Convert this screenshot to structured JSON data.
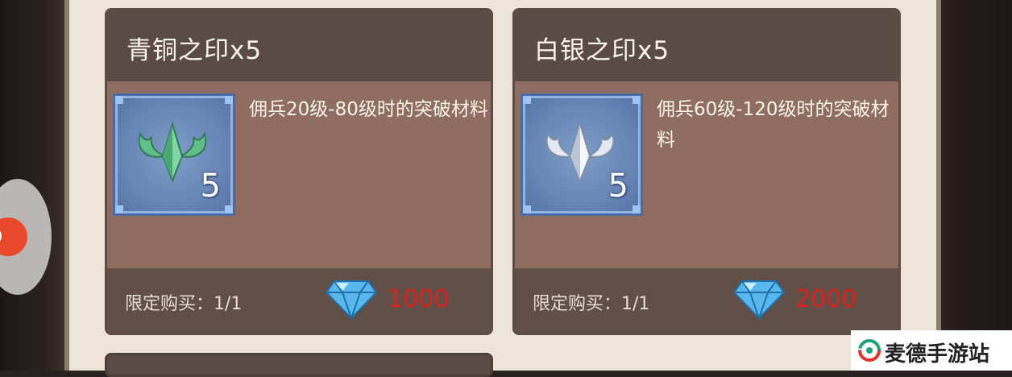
{
  "cards": [
    {
      "title": "青铜之印x5",
      "description": "佣兵20级-80级时的突破材料",
      "count": "5",
      "limit": "限定购买：1/1",
      "price": "1000",
      "icon": "bronze-seal-icon",
      "icon_color": "#6fc38e"
    },
    {
      "title": "白银之印x5",
      "description": "佣兵60级-120级时的突破材料",
      "count": "5",
      "limit": "限定购买：1/1",
      "price": "2000",
      "icon": "silver-seal-icon",
      "icon_color": "#e6ecf4"
    }
  ],
  "currency_icon": "diamond-icon",
  "price_color": "#d8221a",
  "watermark": {
    "text": "麦德手游站"
  }
}
